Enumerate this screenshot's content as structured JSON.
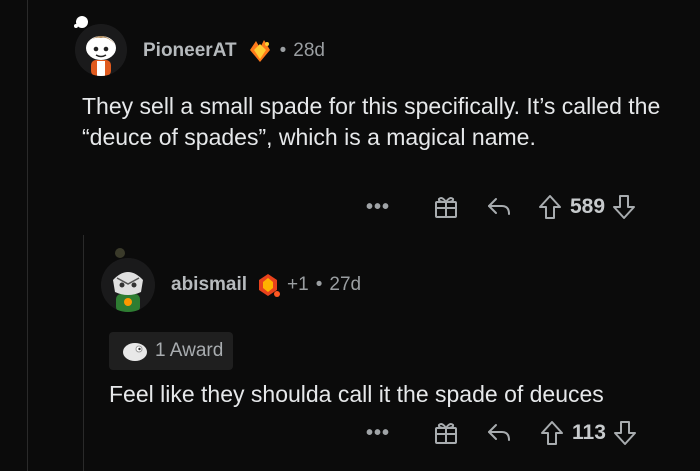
{
  "comments": [
    {
      "username": "PioneerAT",
      "age": "28d",
      "body": "They sell a small spade for this specifically. It’s called the “deuce of spades”, which is a magical name.",
      "votes": "589",
      "more": "•••"
    },
    {
      "username": "abismail",
      "plus": "+1",
      "age": "27d",
      "award_text": "1 Award",
      "body": "Feel like they shoulda call it the spade of deuces",
      "votes": "113",
      "more": "•••"
    }
  ],
  "separator": "•",
  "colors": {
    "background": "#0b0b0b",
    "text": "#e6e8ea",
    "muted": "#9a9ea1"
  },
  "icons": [
    "snoo-avatar-icon",
    "crystal-badge-icon",
    "gift-icon",
    "reply-icon",
    "upvote-icon",
    "downvote-icon",
    "award-icon"
  ]
}
